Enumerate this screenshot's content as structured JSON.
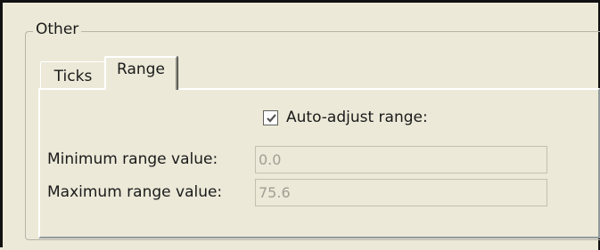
{
  "group": {
    "title": "Other"
  },
  "tabs": [
    {
      "label": "Ticks",
      "active": false
    },
    {
      "label": "Range",
      "active": true
    }
  ],
  "range": {
    "auto_adjust": {
      "label": "Auto-adjust range:",
      "checked": true
    },
    "min": {
      "label": "Minimum range value:",
      "value": "0.0",
      "enabled": false
    },
    "max": {
      "label": "Maximum range value:",
      "value": "75.6",
      "enabled": false
    }
  }
}
